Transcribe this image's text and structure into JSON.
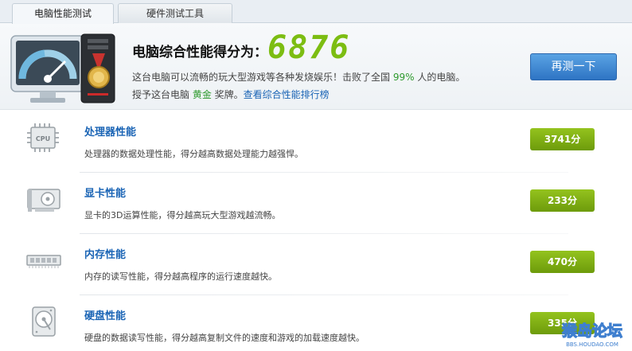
{
  "tabs": [
    {
      "label": "电脑性能测试",
      "active": true
    },
    {
      "label": "硬件测试工具",
      "active": false
    }
  ],
  "summary": {
    "title": "电脑综合性能得分为：",
    "score": "6876",
    "desc_prefix": "这台电脑可以流畅的玩大型游戏等各种发烧娱乐！击败了全国 ",
    "beat_percent": "99%",
    "desc_suffix": " 人的电脑。",
    "award_prefix": "授予这台电脑 ",
    "award_level": "黄金",
    "award_suffix": " 奖牌。",
    "rank_link": "查看综合性能排行榜",
    "retest_label": "再测一下"
  },
  "items": [
    {
      "name": "处理器性能",
      "desc": "处理器的数据处理性能，得分越高数据处理能力越强悍。",
      "score": "3741分",
      "icon": "cpu-icon",
      "icon_text": "CPU"
    },
    {
      "name": "显卡性能",
      "desc": "显卡的3D运算性能，得分越高玩大型游戏越流畅。",
      "score": "233分",
      "icon": "graphics-card-icon"
    },
    {
      "name": "内存性能",
      "desc": "内存的读写性能，得分越高程序的运行速度越快。",
      "score": "470分",
      "icon": "memory-icon"
    },
    {
      "name": "硬盘性能",
      "desc": "硬盘的数据读写性能，得分越高复制文件的速度和游戏的加载速度越快。",
      "score": "335分",
      "icon": "hard-disk-icon"
    }
  ],
  "watermark": {
    "main": "猴岛论坛",
    "sub": "BBS.HOUDAO.COM"
  },
  "colors": {
    "score_green": "#7cbd12",
    "link_blue": "#1a64b5",
    "badge_green": "#7fae14",
    "button_blue": "#3a83d0"
  }
}
